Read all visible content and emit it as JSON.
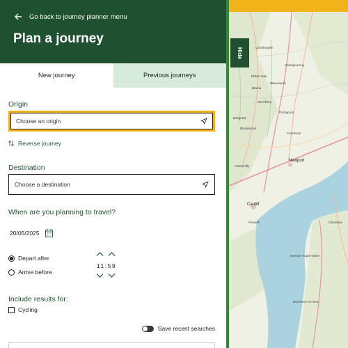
{
  "header": {
    "back_label": "Go back to journey planner menu",
    "title": "Plan a journey"
  },
  "tabs": [
    {
      "label": "New journey",
      "active": true
    },
    {
      "label": "Previous journeys",
      "active": false
    }
  ],
  "origin": {
    "label": "Origin",
    "placeholder": "Choose an origin",
    "value": ""
  },
  "reverse_label": "Reverse journey",
  "destination": {
    "label": "Destination",
    "placeholder": "Choose a destination",
    "value": ""
  },
  "when": {
    "label": "When are you planning to travel?",
    "date": "20/05/2025",
    "options": [
      {
        "label": "Depart after",
        "selected": true
      },
      {
        "label": "Arrive before",
        "selected": false
      }
    ],
    "time": "11:59"
  },
  "include": {
    "label": "Include results for:",
    "options": [
      {
        "label": "Cycling",
        "checked": false
      }
    ]
  },
  "save_recent": {
    "label": "Save recent searches",
    "on": false
  },
  "map": {
    "hide_label": "Hide",
    "places": [
      {
        "name": "Crickhowell"
      },
      {
        "name": "Abergavenny"
      },
      {
        "name": "Ebbw Vale"
      },
      {
        "name": "Blaenavon"
      },
      {
        "name": "Blaina"
      },
      {
        "name": "Abertillery"
      },
      {
        "name": "Pontypool"
      },
      {
        "name": "Bargoed"
      },
      {
        "name": "Blackwood"
      },
      {
        "name": "Cwmbran"
      },
      {
        "name": "Newport"
      },
      {
        "name": "Caerphilly"
      },
      {
        "name": "Cardiff"
      },
      {
        "name": "Penarth"
      },
      {
        "name": "Clevedon"
      },
      {
        "name": "Weston-super-Mare"
      },
      {
        "name": "Burnham-on-Sea"
      }
    ]
  },
  "colors": {
    "brand_green": "#1f5130",
    "tab_inactive": "#d6ebd9",
    "focus_yellow": "#f2b21a",
    "divider_green": "#2e8b2e",
    "water": "#aad3df"
  }
}
